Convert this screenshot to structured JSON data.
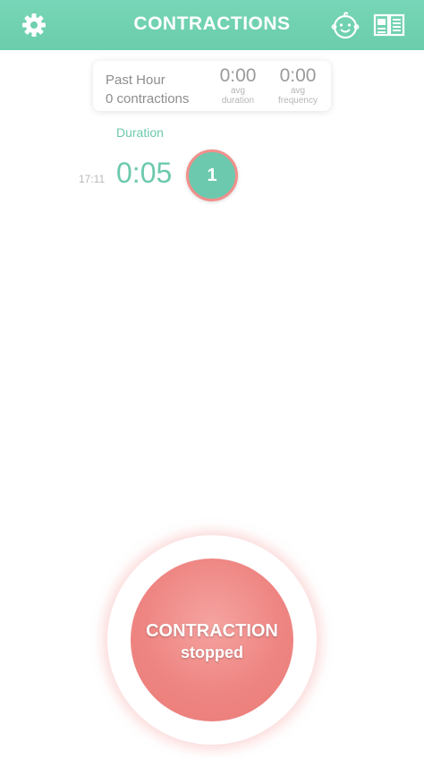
{
  "header": {
    "title": "CONTRACTIONS",
    "settings_icon": "gear-icon",
    "baby_icon": "baby-face-icon",
    "book_icon": "book-icon"
  },
  "summary": {
    "period_label": "Past Hour",
    "count_label": "0 contractions",
    "avg_duration_value": "0:00",
    "avg_duration_label_line1": "avg",
    "avg_duration_label_line2": "duration",
    "avg_frequency_value": "0:00",
    "avg_frequency_label_line1": "avg",
    "avg_frequency_label_line2": "frequency"
  },
  "list": {
    "column_header": "Duration",
    "rows": [
      {
        "time": "17:11",
        "duration": "0:05",
        "number": "1"
      }
    ]
  },
  "main_button": {
    "line1": "CONTRACTION",
    "line2": "stopped"
  },
  "colors": {
    "accent": "#6fd0b0",
    "button": "#ee8582"
  }
}
